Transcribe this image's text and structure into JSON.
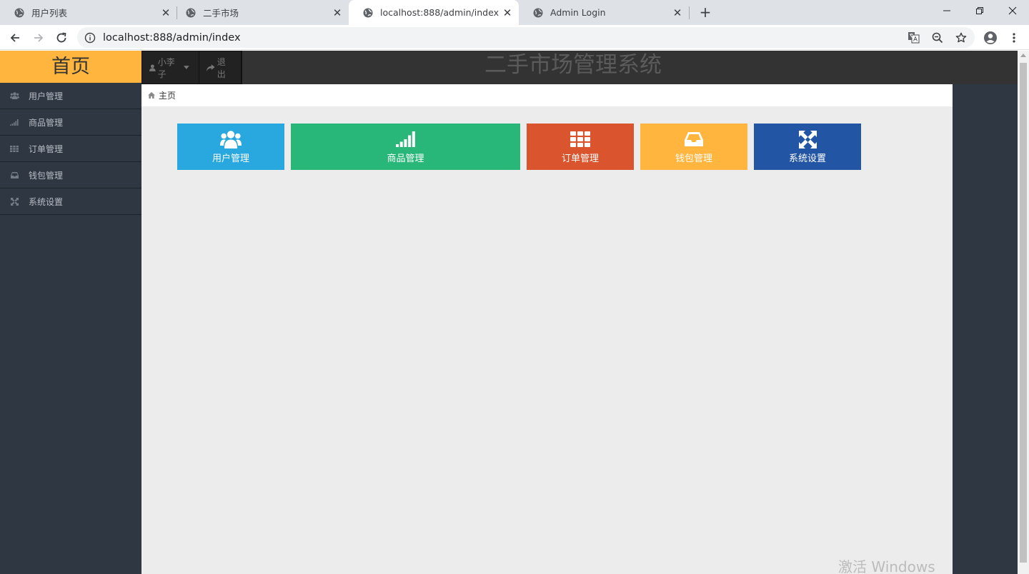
{
  "browser": {
    "tabs": [
      {
        "title": "用户列表",
        "active": false
      },
      {
        "title": "二手市场",
        "active": false
      },
      {
        "title": "localhost:888/admin/index",
        "active": true
      },
      {
        "title": "Admin Login",
        "active": false
      }
    ],
    "close_glyph": "✕",
    "new_tab_glyph": "+",
    "url": "localhost:888/admin/index"
  },
  "app": {
    "brand": "首页",
    "system_title": "二手市场管理系统",
    "user_menu": {
      "username": "小李子",
      "logout": "退出"
    },
    "sidebar": {
      "items": [
        {
          "label": "用户管理",
          "icon": "users-icon"
        },
        {
          "label": "商品管理",
          "icon": "signal-icon"
        },
        {
          "label": "订单管理",
          "icon": "grid-icon"
        },
        {
          "label": "钱包管理",
          "icon": "inbox-icon"
        },
        {
          "label": "系统设置",
          "icon": "arrows-icon"
        }
      ]
    },
    "breadcrumb": {
      "current": "主页"
    },
    "tiles": [
      {
        "label": "用户管理",
        "icon": "users-icon",
        "color": "#29a8e0"
      },
      {
        "label": "商品管理",
        "icon": "signal-icon",
        "color": "#28b779"
      },
      {
        "label": "订单管理",
        "icon": "grid-icon",
        "color": "#da542e"
      },
      {
        "label": "钱包管理",
        "icon": "inbox-icon",
        "color": "#ffb53e"
      },
      {
        "label": "系统设置",
        "icon": "arrows-icon",
        "color": "#2255a4"
      }
    ],
    "watermark": "激活 Windows"
  },
  "colors": {
    "brand": "#ffb53e",
    "topbar": "#333333",
    "sidebar": "#2f3742",
    "content": "#ececec"
  }
}
